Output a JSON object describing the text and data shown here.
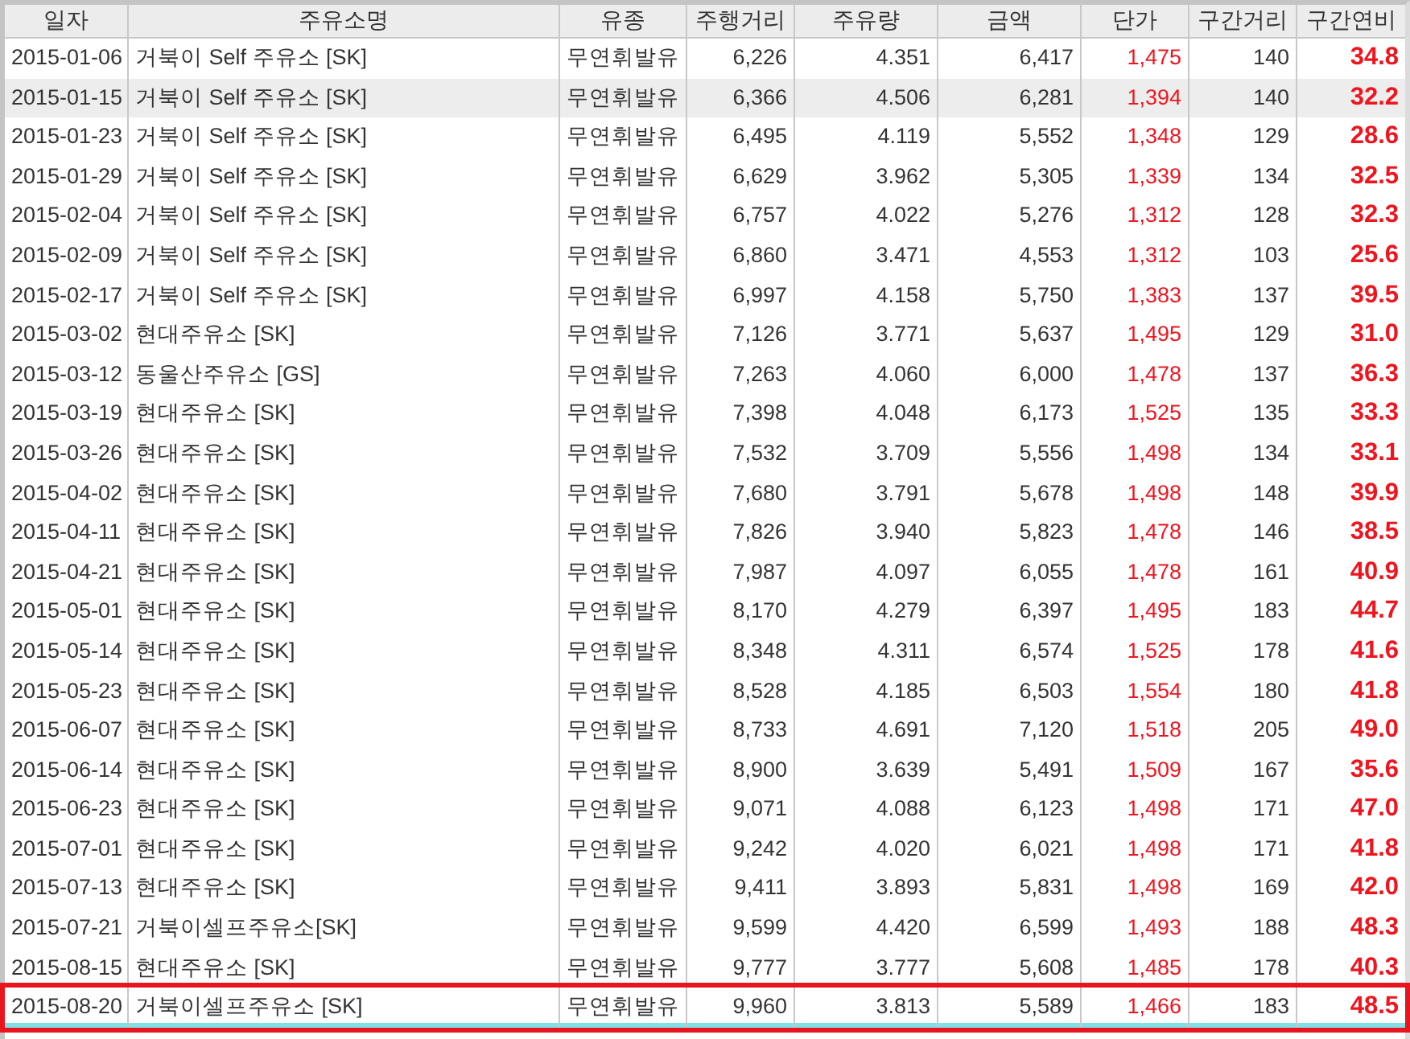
{
  "table": {
    "columns": [
      "일자",
      "주유소명",
      "유종",
      "주행거리",
      "주유량",
      "금액",
      "단가",
      "구간거리",
      "구간연비"
    ],
    "rows": [
      {
        "date": "2015-01-06",
        "station": "거북이 Self 주유소 [SK]",
        "fuel": "무연휘발유",
        "odometer": "6,226",
        "liters": "4.351",
        "amount": "6,417",
        "unit_price": "1,475",
        "distance": "140",
        "efficiency": "34.8",
        "selected": false,
        "highlighted": false
      },
      {
        "date": "2015-01-15",
        "station": "거북이 Self 주유소 [SK]",
        "fuel": "무연휘발유",
        "odometer": "6,366",
        "liters": "4.506",
        "amount": "6,281",
        "unit_price": "1,394",
        "distance": "140",
        "efficiency": "32.2",
        "selected": true,
        "highlighted": false
      },
      {
        "date": "2015-01-23",
        "station": "거북이 Self 주유소 [SK]",
        "fuel": "무연휘발유",
        "odometer": "6,495",
        "liters": "4.119",
        "amount": "5,552",
        "unit_price": "1,348",
        "distance": "129",
        "efficiency": "28.6",
        "selected": false,
        "highlighted": false
      },
      {
        "date": "2015-01-29",
        "station": "거북이 Self 주유소 [SK]",
        "fuel": "무연휘발유",
        "odometer": "6,629",
        "liters": "3.962",
        "amount": "5,305",
        "unit_price": "1,339",
        "distance": "134",
        "efficiency": "32.5",
        "selected": false,
        "highlighted": false
      },
      {
        "date": "2015-02-04",
        "station": "거북이 Self 주유소 [SK]",
        "fuel": "무연휘발유",
        "odometer": "6,757",
        "liters": "4.022",
        "amount": "5,276",
        "unit_price": "1,312",
        "distance": "128",
        "efficiency": "32.3",
        "selected": false,
        "highlighted": false
      },
      {
        "date": "2015-02-09",
        "station": "거북이 Self 주유소 [SK]",
        "fuel": "무연휘발유",
        "odometer": "6,860",
        "liters": "3.471",
        "amount": "4,553",
        "unit_price": "1,312",
        "distance": "103",
        "efficiency": "25.6",
        "selected": false,
        "highlighted": false
      },
      {
        "date": "2015-02-17",
        "station": "거북이 Self 주유소 [SK]",
        "fuel": "무연휘발유",
        "odometer": "6,997",
        "liters": "4.158",
        "amount": "5,750",
        "unit_price": "1,383",
        "distance": "137",
        "efficiency": "39.5",
        "selected": false,
        "highlighted": false
      },
      {
        "date": "2015-03-02",
        "station": "현대주유소 [SK]",
        "fuel": "무연휘발유",
        "odometer": "7,126",
        "liters": "3.771",
        "amount": "5,637",
        "unit_price": "1,495",
        "distance": "129",
        "efficiency": "31.0",
        "selected": false,
        "highlighted": false
      },
      {
        "date": "2015-03-12",
        "station": "동울산주유소 [GS]",
        "fuel": "무연휘발유",
        "odometer": "7,263",
        "liters": "4.060",
        "amount": "6,000",
        "unit_price": "1,478",
        "distance": "137",
        "efficiency": "36.3",
        "selected": false,
        "highlighted": false
      },
      {
        "date": "2015-03-19",
        "station": "현대주유소 [SK]",
        "fuel": "무연휘발유",
        "odometer": "7,398",
        "liters": "4.048",
        "amount": "6,173",
        "unit_price": "1,525",
        "distance": "135",
        "efficiency": "33.3",
        "selected": false,
        "highlighted": false
      },
      {
        "date": "2015-03-26",
        "station": "현대주유소 [SK]",
        "fuel": "무연휘발유",
        "odometer": "7,532",
        "liters": "3.709",
        "amount": "5,556",
        "unit_price": "1,498",
        "distance": "134",
        "efficiency": "33.1",
        "selected": false,
        "highlighted": false
      },
      {
        "date": "2015-04-02",
        "station": "현대주유소 [SK]",
        "fuel": "무연휘발유",
        "odometer": "7,680",
        "liters": "3.791",
        "amount": "5,678",
        "unit_price": "1,498",
        "distance": "148",
        "efficiency": "39.9",
        "selected": false,
        "highlighted": false
      },
      {
        "date": "2015-04-11",
        "station": "현대주유소 [SK]",
        "fuel": "무연휘발유",
        "odometer": "7,826",
        "liters": "3.940",
        "amount": "5,823",
        "unit_price": "1,478",
        "distance": "146",
        "efficiency": "38.5",
        "selected": false,
        "highlighted": false
      },
      {
        "date": "2015-04-21",
        "station": "현대주유소 [SK]",
        "fuel": "무연휘발유",
        "odometer": "7,987",
        "liters": "4.097",
        "amount": "6,055",
        "unit_price": "1,478",
        "distance": "161",
        "efficiency": "40.9",
        "selected": false,
        "highlighted": false
      },
      {
        "date": "2015-05-01",
        "station": "현대주유소 [SK]",
        "fuel": "무연휘발유",
        "odometer": "8,170",
        "liters": "4.279",
        "amount": "6,397",
        "unit_price": "1,495",
        "distance": "183",
        "efficiency": "44.7",
        "selected": false,
        "highlighted": false
      },
      {
        "date": "2015-05-14",
        "station": "현대주유소 [SK]",
        "fuel": "무연휘발유",
        "odometer": "8,348",
        "liters": "4.311",
        "amount": "6,574",
        "unit_price": "1,525",
        "distance": "178",
        "efficiency": "41.6",
        "selected": false,
        "highlighted": false
      },
      {
        "date": "2015-05-23",
        "station": "현대주유소 [SK]",
        "fuel": "무연휘발유",
        "odometer": "8,528",
        "liters": "4.185",
        "amount": "6,503",
        "unit_price": "1,554",
        "distance": "180",
        "efficiency": "41.8",
        "selected": false,
        "highlighted": false
      },
      {
        "date": "2015-06-07",
        "station": "현대주유소 [SK]",
        "fuel": "무연휘발유",
        "odometer": "8,733",
        "liters": "4.691",
        "amount": "7,120",
        "unit_price": "1,518",
        "distance": "205",
        "efficiency": "49.0",
        "selected": false,
        "highlighted": false
      },
      {
        "date": "2015-06-14",
        "station": "현대주유소 [SK]",
        "fuel": "무연휘발유",
        "odometer": "8,900",
        "liters": "3.639",
        "amount": "5,491",
        "unit_price": "1,509",
        "distance": "167",
        "efficiency": "35.6",
        "selected": false,
        "highlighted": false
      },
      {
        "date": "2015-06-23",
        "station": "현대주유소 [SK]",
        "fuel": "무연휘발유",
        "odometer": "9,071",
        "liters": "4.088",
        "amount": "6,123",
        "unit_price": "1,498",
        "distance": "171",
        "efficiency": "47.0",
        "selected": false,
        "highlighted": false
      },
      {
        "date": "2015-07-01",
        "station": "현대주유소 [SK]",
        "fuel": "무연휘발유",
        "odometer": "9,242",
        "liters": "4.020",
        "amount": "6,021",
        "unit_price": "1,498",
        "distance": "171",
        "efficiency": "41.8",
        "selected": false,
        "highlighted": false
      },
      {
        "date": "2015-07-13",
        "station": "현대주유소 [SK]",
        "fuel": "무연휘발유",
        "odometer": "9,411",
        "liters": "3.893",
        "amount": "5,831",
        "unit_price": "1,498",
        "distance": "169",
        "efficiency": "42.0",
        "selected": false,
        "highlighted": false
      },
      {
        "date": "2015-07-21",
        "station": "거북이셀프주유소[SK]",
        "fuel": "무연휘발유",
        "odometer": "9,599",
        "liters": "4.420",
        "amount": "6,599",
        "unit_price": "1,493",
        "distance": "188",
        "efficiency": "48.3",
        "selected": false,
        "highlighted": false
      },
      {
        "date": "2015-08-15",
        "station": "현대주유소 [SK]",
        "fuel": "무연휘발유",
        "odometer": "9,777",
        "liters": "3.777",
        "amount": "5,608",
        "unit_price": "1,485",
        "distance": "178",
        "efficiency": "40.3",
        "selected": false,
        "highlighted": false
      },
      {
        "date": "2015-08-20",
        "station": "거북이셀프주유소 [SK]",
        "fuel": "무연휘발유",
        "odometer": "9,960",
        "liters": "3.813",
        "amount": "5,589",
        "unit_price": "1,466",
        "distance": "183",
        "efficiency": "48.5",
        "selected": false,
        "highlighted": true
      }
    ]
  }
}
